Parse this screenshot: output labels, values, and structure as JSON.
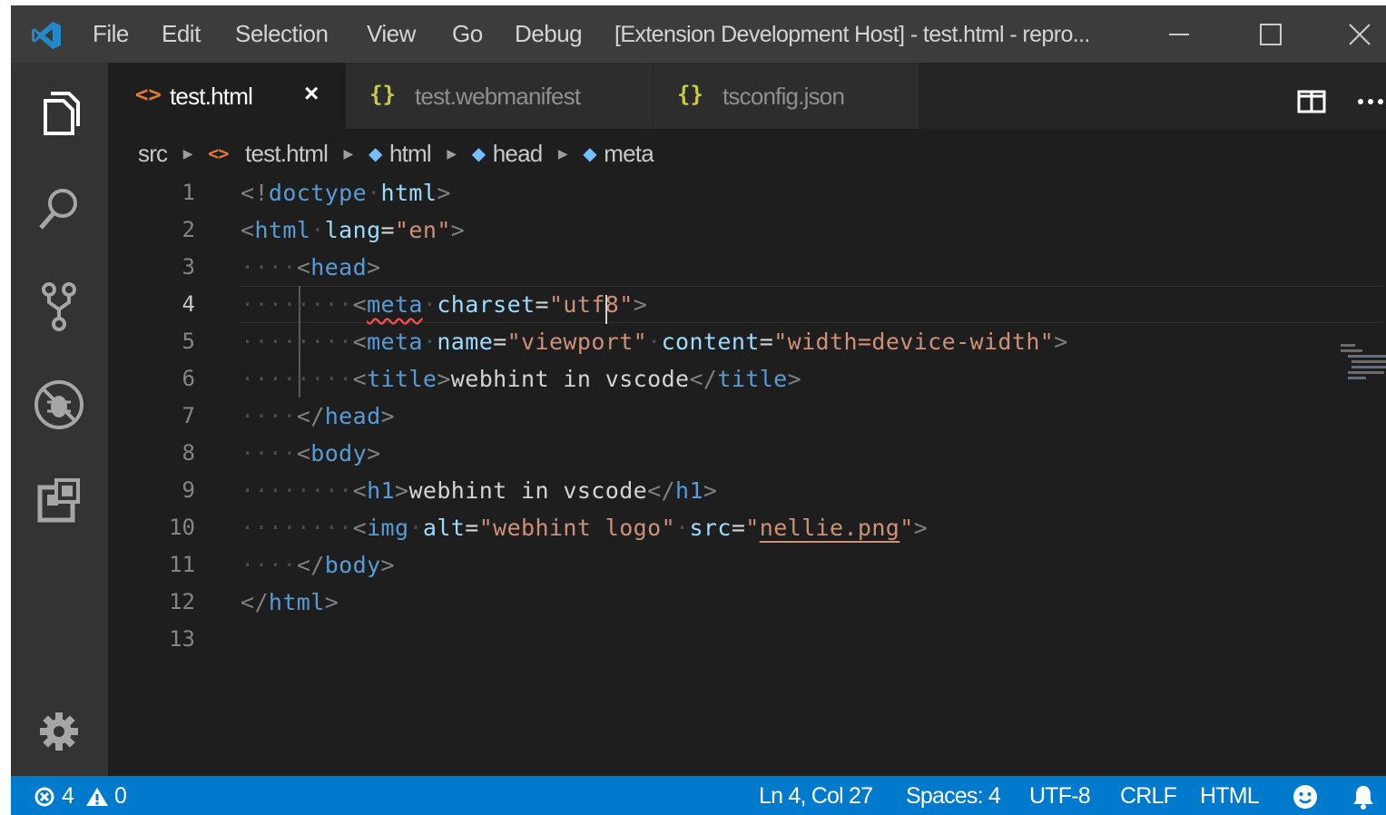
{
  "titlebar": {
    "menu": [
      "File",
      "Edit",
      "Selection",
      "View",
      "Go",
      "Debug"
    ],
    "window_title": "[Extension Development Host] - test.html - repro..."
  },
  "activity": {
    "icons": [
      "explorer-icon",
      "search-icon",
      "source-control-icon",
      "debug-icon",
      "extensions-icon",
      "gear-icon"
    ]
  },
  "tabs": [
    {
      "label": "test.html",
      "icon": "<>",
      "active": true,
      "close": "×"
    },
    {
      "label": "test.webmanifest",
      "icon": "{}",
      "active": false
    },
    {
      "label": "tsconfig.json",
      "icon": "{}",
      "active": false
    }
  ],
  "breadcrumb": {
    "folder": "src",
    "file_icon": "<>",
    "file": "test.html",
    "symbols": [
      "html",
      "head",
      "meta"
    ]
  },
  "editor": {
    "line_numbers": [
      "1",
      "2",
      "3",
      "4",
      "5",
      "6",
      "7",
      "8",
      "9",
      "10",
      "11",
      "12",
      "13"
    ],
    "active_line": 4,
    "tokens": {
      "doctype_open": "<!",
      "doctype_kw": "doctype",
      "doctype_arg": "html",
      "gt": ">",
      "lt": "<",
      "lts": "</",
      "eq": "=",
      "html": "html",
      "head": "head",
      "meta": "meta",
      "title": "title",
      "body": "body",
      "h1": "h1",
      "img": "img",
      "lang": "lang",
      "lang_val": "\"en\"",
      "charset": "charset",
      "charset_val": "\"utf8\"",
      "name": "name",
      "name_val": "\"viewport\"",
      "content": "content",
      "content_val": "\"width=device-width\"",
      "title_text": "webhint in vscode",
      "h1_text": "webhint in vscode",
      "alt": "alt",
      "alt_val": "\"webhint logo\"",
      "src": "src",
      "src_q": "\"",
      "src_val": "nellie.png"
    }
  },
  "statusbar": {
    "errors": "4",
    "warnings": "0",
    "position": "Ln 4, Col 27",
    "spaces": "Spaces: 4",
    "encoding": "UTF-8",
    "eol": "CRLF",
    "language": "HTML"
  },
  "colors": {
    "statusbar_bg": "#007acc",
    "editor_bg": "#1e1e1e",
    "tag": "#569cd6",
    "attr": "#9cdcfe",
    "string": "#ce9178"
  }
}
